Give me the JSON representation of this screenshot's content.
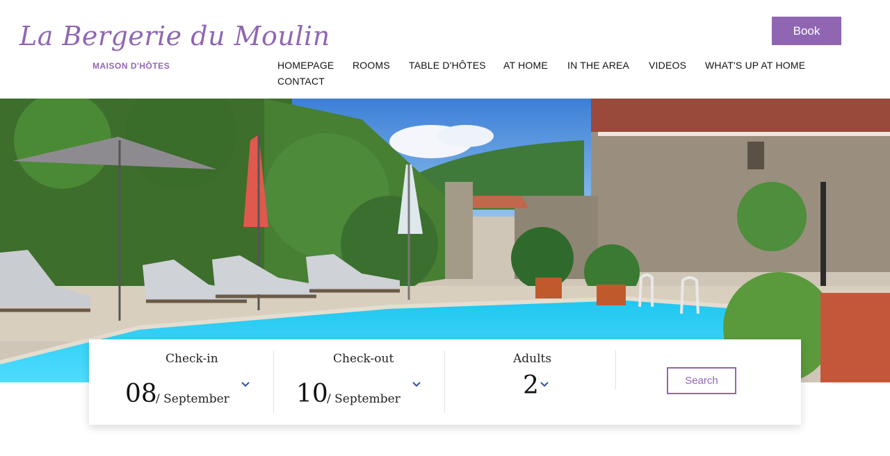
{
  "brand": {
    "name": "La Bergerie du Moulin",
    "tagline": "MAISON D'HÔTES",
    "color": "#9066b3"
  },
  "header": {
    "book_label": "Book",
    "nav": [
      {
        "label": "HOMEPAGE"
      },
      {
        "label": "ROOMS"
      },
      {
        "label": "TABLE D'HÔTES"
      },
      {
        "label": "AT HOME"
      },
      {
        "label": "IN THE AREA"
      },
      {
        "label": "VIDEOS"
      },
      {
        "label": "WHAT'S UP AT HOME"
      },
      {
        "label": "CONTACT"
      }
    ]
  },
  "booking": {
    "checkin": {
      "label": "Check-in",
      "day": "08",
      "month": "/ September"
    },
    "checkout": {
      "label": "Check-out",
      "day": "10",
      "month": "/ September"
    },
    "adults": {
      "label": "Adults",
      "value": "2"
    },
    "search_label": "Search",
    "chevron_icon": "chevron-down-icon",
    "chevron_color": "#2b4fa8"
  }
}
